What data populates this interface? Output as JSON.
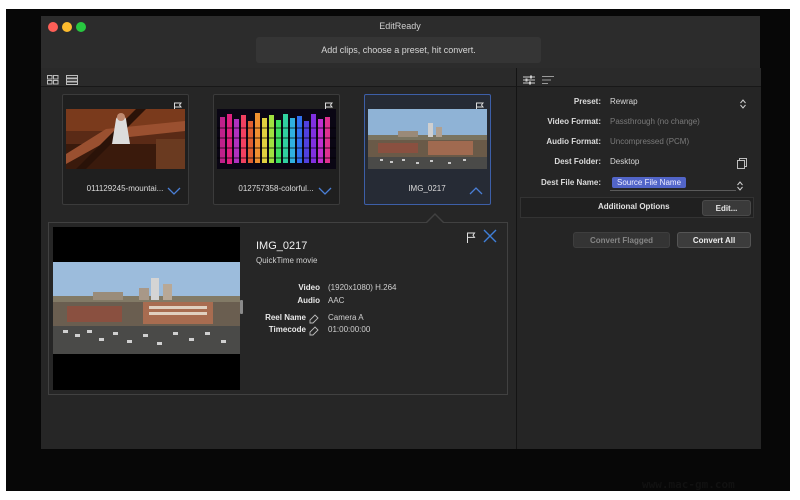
{
  "window": {
    "title": "EditReady"
  },
  "hint": {
    "text": "Add clips, choose a preset, hit convert."
  },
  "clips": [
    {
      "label": "011129245-mountai..."
    },
    {
      "label": "012757358-colorful..."
    },
    {
      "label": "IMG_0217"
    }
  ],
  "detail": {
    "name": "IMG_0217",
    "format": "QuickTime movie",
    "fields": [
      {
        "label": "Video",
        "value": "(1920x1080) H.264"
      },
      {
        "label": "Audio",
        "value": "AAC"
      },
      {
        "label": "Reel Name",
        "value": "Camera A"
      },
      {
        "label": "Timecode",
        "value": "01:00:00:00"
      }
    ]
  },
  "sidebar": {
    "preset": {
      "label": "Preset:",
      "value": "Rewrap"
    },
    "video_format": {
      "label": "Video Format:",
      "value": "Passthrough (no change)"
    },
    "audio_format": {
      "label": "Audio Format:",
      "value": "Uncompressed (PCM)"
    },
    "dest_folder": {
      "label": "Dest Folder:",
      "value": "Desktop"
    },
    "dest_file_name": {
      "label": "Dest File Name:",
      "token": "Source File Name"
    },
    "additional_options": {
      "label": "Additional Options",
      "button": "Edit..."
    },
    "convert_flagged": "Convert Flagged",
    "convert_all": "Convert All"
  },
  "watermark": {
    "text": "www.mac-gm.com"
  },
  "colors": {
    "accent": "#3d5fa8",
    "token_bg": "#5265c8",
    "background": "#262626"
  }
}
